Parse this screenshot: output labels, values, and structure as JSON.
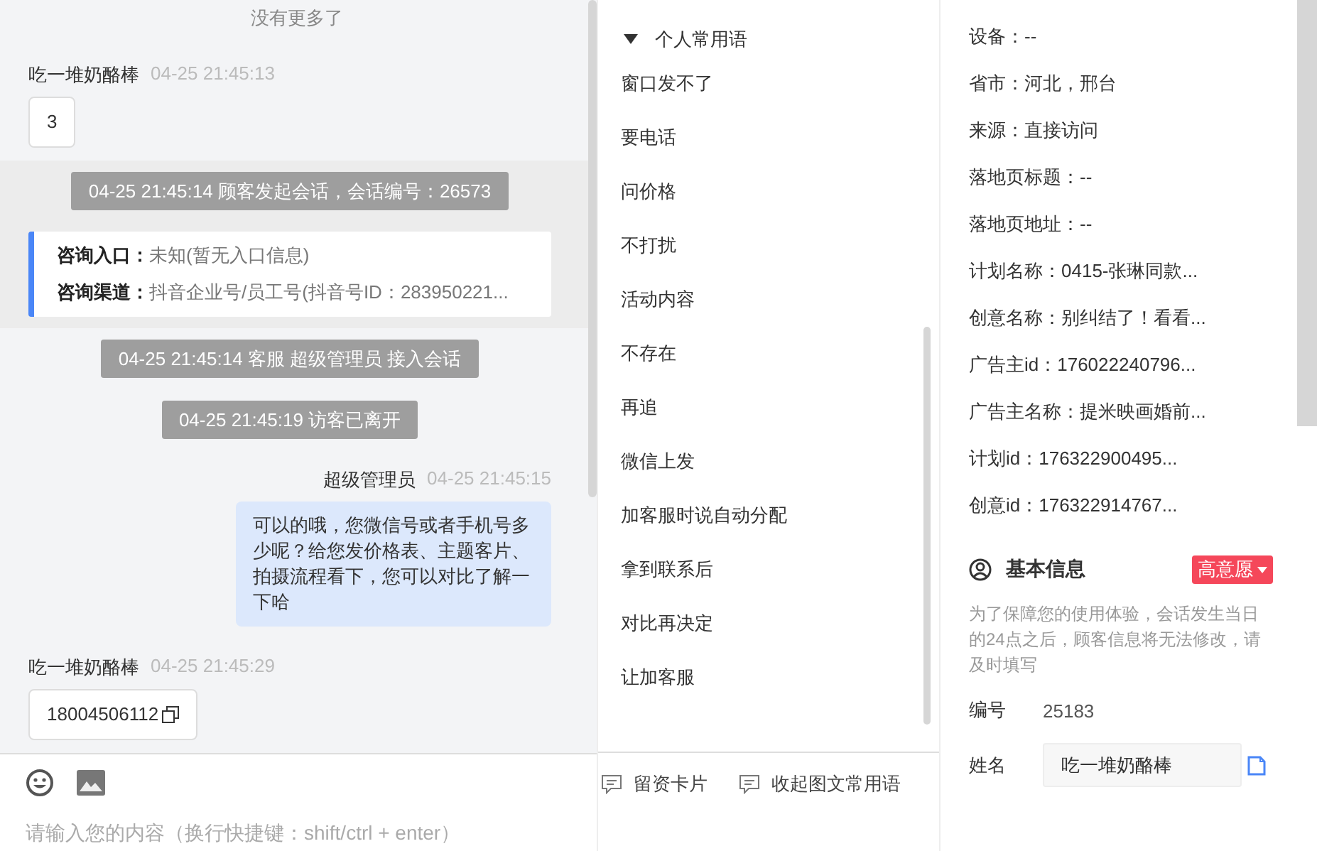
{
  "chat": {
    "no_more": "没有更多了",
    "messages": [
      {
        "kind": "visitor",
        "sender": "吃一堆奶酪棒",
        "time": "04-25 21:45:13",
        "text": "3",
        "copyable": false
      },
      {
        "kind": "band",
        "notice": "04-25 21:45:14 顾客发起会话，会话编号：26573",
        "entry": [
          {
            "label": "咨询入口：",
            "value": "未知(暂无入口信息)"
          },
          {
            "label": "咨询渠道：",
            "value": "抖音企业号/员工号(抖音号ID：283950221..."
          }
        ]
      },
      {
        "kind": "system",
        "text": "04-25 21:45:14 客服 超级管理员 接入会话"
      },
      {
        "kind": "system",
        "text": "04-25 21:45:19 访客已离开"
      },
      {
        "kind": "agent",
        "sender": "超级管理员",
        "time": "04-25 21:45:15",
        "text": "可以的哦，您微信号或者手机号多少呢？给您发价格表、主题客片、拍摄流程看下，您可以对比了解一下哈"
      },
      {
        "kind": "visitor",
        "sender": "吃一堆奶酪棒",
        "time": "04-25 21:45:29",
        "text": "18004506112",
        "copyable": true
      }
    ],
    "input": {
      "placeholder": "请输入您的内容（换行快捷键：shift/ctrl + enter）"
    }
  },
  "phrases": {
    "group": {
      "label": "个人常用语",
      "expanded": true
    },
    "items": [
      "窗口发不了",
      "要电话",
      "问价格",
      "不打扰",
      "活动内容",
      "不存在",
      "再追",
      "微信上发",
      "加客服时说自动分配",
      "拿到联系后",
      "对比再决定",
      "让加客服"
    ],
    "actions": [
      "留资卡片",
      "收起图文常用语"
    ]
  },
  "visitor_info": {
    "rows": [
      "设备：--",
      "省市：河北，邢台",
      "来源：直接访问",
      "落地页标题：--",
      "落地页地址：--",
      "计划名称：0415-张琳同款...",
      "创意名称：别纠结了！看看...",
      "广告主id：176022240796...",
      "广告主名称：提米映画婚前...",
      "计划id：176322900495...",
      "创意id：176322914767..."
    ],
    "basic": {
      "title": "基本信息",
      "intent": "高意愿",
      "notice": "为了保障您的使用体验，会话发生当日的24点之后，顾客信息将无法修改，请及时填写",
      "fields": [
        {
          "kind": "text",
          "label": "编号",
          "value": "25183"
        },
        {
          "kind": "input",
          "label": "姓名",
          "value": "吃一堆奶酪棒"
        }
      ]
    }
  }
}
